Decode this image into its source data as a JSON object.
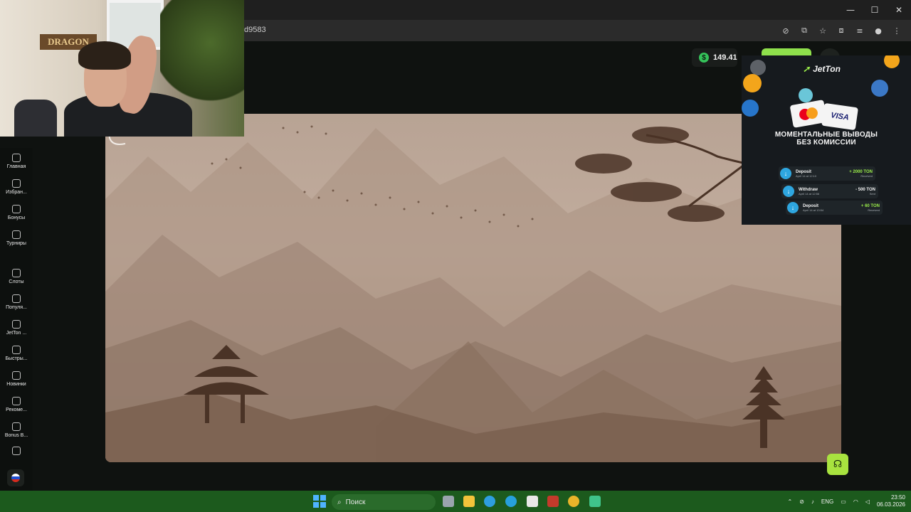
{
  "browser": {
    "url_fragment": "d9583",
    "window_controls": [
      "—",
      "☐",
      "✕"
    ]
  },
  "header": {
    "balance": "149.41",
    "currency_symbol": "$"
  },
  "sidebar": {
    "items": [
      {
        "label": "Главная",
        "icon": "home-icon"
      },
      {
        "label": "Избран...",
        "icon": "star-icon"
      },
      {
        "label": "Бонусы",
        "icon": "gift-icon"
      },
      {
        "label": "Турниры",
        "icon": "trophy-icon"
      },
      {
        "label": "Слоты",
        "icon": "slots-icon"
      },
      {
        "label": "Популя...",
        "icon": "fire-icon"
      },
      {
        "label": "JetTon ...",
        "icon": "plane-icon"
      },
      {
        "label": "Быстры...",
        "icon": "lightning-icon"
      },
      {
        "label": "Новинки",
        "icon": "new-icon"
      },
      {
        "label": "Рекоме...",
        "icon": "recommend-icon"
      },
      {
        "label": "Bonus B...",
        "icon": "bonus-buy-icon"
      },
      {
        "label": "",
        "icon": "shield-icon"
      }
    ]
  },
  "webcam": {
    "sign_text": "DRAGON"
  },
  "ad": {
    "brand": "JetTon",
    "card_mastercard": "MasterCard",
    "card_visa": "VISA",
    "headline_line1": "МОМЕНТАЛЬНЫЕ ВЫВОДЫ",
    "headline_line2": "БЕЗ КОМИССИИ",
    "transactions": [
      {
        "name": "Deposit",
        "date": "April 14 at 12:10",
        "amount": "+ 2000 TON",
        "status": "Received"
      },
      {
        "name": "Withdraw",
        "date": "April 14 at 12:56",
        "amount": "- 500 TON",
        "status": "Sent"
      },
      {
        "name": "Deposit",
        "date": "April 14 at 13:54",
        "amount": "+ 60 TON",
        "status": "Received"
      }
    ]
  },
  "taskbar": {
    "search_placeholder": "Поиск",
    "language": "ENG",
    "time": "23:50",
    "date": "06.03.2026"
  },
  "colors": {
    "accent_green": "#8fe04c",
    "taskbar": "#1c5a1d",
    "game_sepia": "#b8a394"
  }
}
